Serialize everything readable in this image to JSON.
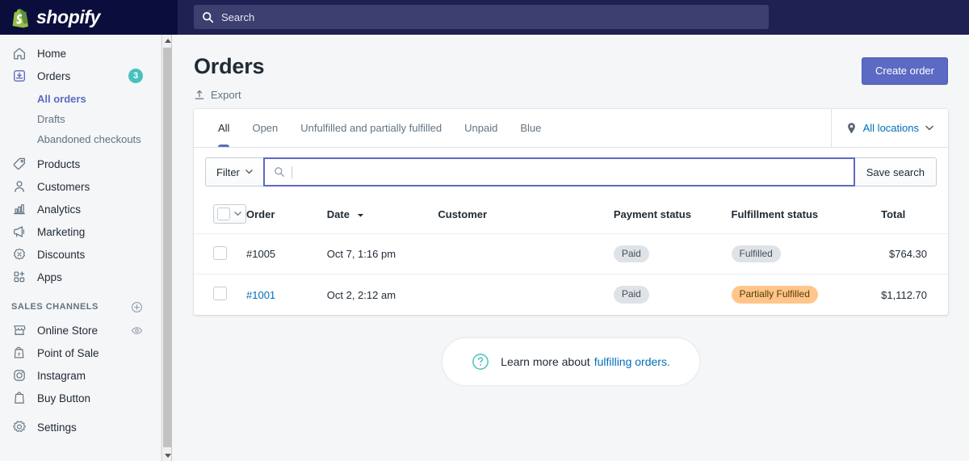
{
  "topbar": {
    "brand_name": "shopify",
    "search_placeholder": "Search",
    "search_value": ""
  },
  "sidebar": {
    "items": [
      {
        "label": "Home",
        "icon": "home-icon",
        "badge": ""
      },
      {
        "label": "Orders",
        "icon": "orders-inbox-icon",
        "badge": "3"
      },
      {
        "label": "Products",
        "icon": "tag-icon",
        "badge": ""
      },
      {
        "label": "Customers",
        "icon": "person-icon",
        "badge": ""
      },
      {
        "label": "Analytics",
        "icon": "bar-chart-icon",
        "badge": ""
      },
      {
        "label": "Marketing",
        "icon": "megaphone-icon",
        "badge": ""
      },
      {
        "label": "Discounts",
        "icon": "discount-percent-icon",
        "badge": ""
      },
      {
        "label": "Apps",
        "icon": "apps-grid-plus-icon",
        "badge": ""
      }
    ],
    "orders_subnav": [
      {
        "label": "All orders",
        "active": true
      },
      {
        "label": "Drafts",
        "active": false
      },
      {
        "label": "Abandoned checkouts",
        "active": false
      }
    ],
    "sales_channels_heading": "SALES CHANNELS",
    "sales_channels": [
      {
        "label": "Online Store",
        "icon": "storefront-icon",
        "trailing": "eye-icon"
      },
      {
        "label": "Point of Sale",
        "icon": "pos-bag-icon",
        "trailing": ""
      },
      {
        "label": "Instagram",
        "icon": "instagram-icon",
        "trailing": ""
      },
      {
        "label": "Buy Button",
        "icon": "shopping-bag-icon",
        "trailing": ""
      }
    ],
    "settings": {
      "label": "Settings",
      "icon": "gear-icon"
    }
  },
  "page": {
    "title": "Orders",
    "export_label": "Export",
    "create_order_label": "Create order"
  },
  "tabs": [
    {
      "label": "All",
      "active": true
    },
    {
      "label": "Open",
      "active": false
    },
    {
      "label": "Unfulfilled and partially fulfilled",
      "active": false
    },
    {
      "label": "Unpaid",
      "active": false
    },
    {
      "label": "Blue",
      "active": false
    }
  ],
  "locations": {
    "label": "All locations",
    "icon": "map-pin-icon"
  },
  "filterbar": {
    "filter_label": "Filter",
    "search_value": "",
    "search_placeholder": "",
    "save_search_label": "Save search"
  },
  "table": {
    "headers": {
      "order": "Order",
      "date": "Date",
      "customer": "Customer",
      "payment_status": "Payment status",
      "fulfillment_status": "Fulfillment status",
      "total": "Total"
    },
    "sort_column": "Date",
    "rows": [
      {
        "order": "#1005",
        "order_is_link": false,
        "date": "Oct 7, 1:16 pm",
        "customer": "",
        "payment_status": "Paid",
        "payment_tone": "default",
        "fulfillment_status": "Fulfilled",
        "fulfillment_tone": "default",
        "total": "$764.30"
      },
      {
        "order": "#1001",
        "order_is_link": true,
        "date": "Oct 2, 2:12 am",
        "customer": "",
        "payment_status": "Paid",
        "payment_tone": "default",
        "fulfillment_status": "Partially Fulfilled",
        "fulfillment_tone": "warning",
        "total": "$1,112.70"
      }
    ]
  },
  "footer_help": {
    "text": "Learn more about",
    "link": "fulfilling orders.",
    "icon": "question-circle-icon"
  },
  "colors": {
    "brand_dark": "#0b0e3d",
    "topbar": "#1f2152",
    "accent_purple": "#5c6ac4",
    "link_blue": "#006fbb",
    "teal": "#47c1bf",
    "badge_warning_bg": "#ffc58b",
    "badge_default_bg": "#dfe3e8",
    "page_bg": "#f4f6f8"
  }
}
